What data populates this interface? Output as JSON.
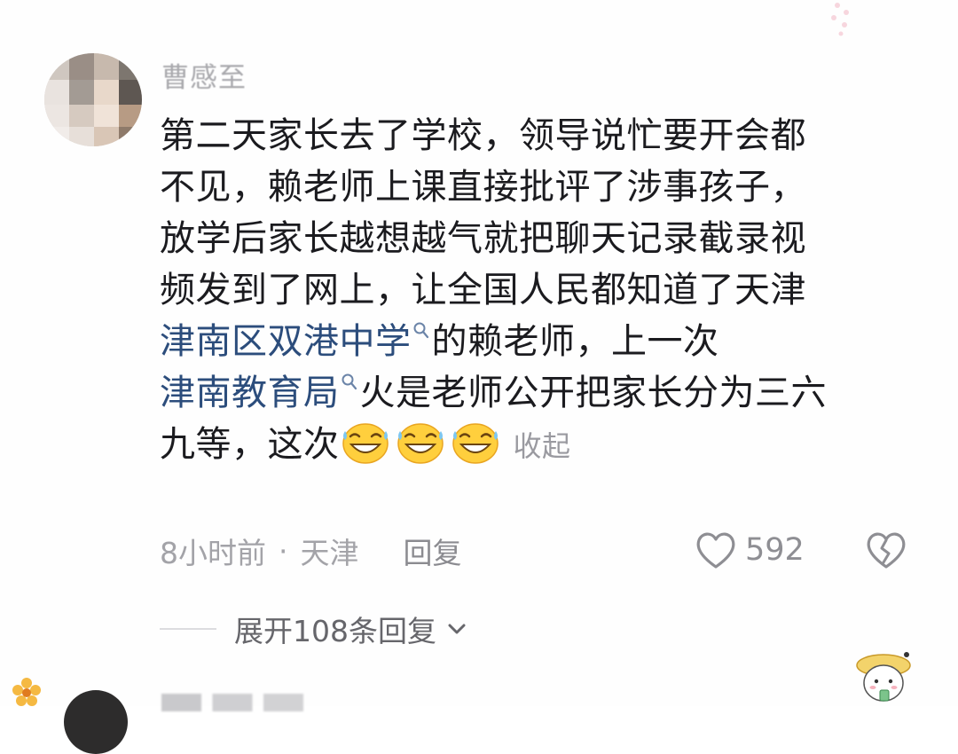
{
  "comment": {
    "username": "曹感至",
    "lines": [
      "第二天家长去了学校，领导说忙要开会都",
      "不见，赖老师上课直接批评了涉事孩子，",
      "放学后家长越想越气就把聊天记录截录视",
      "频发到了网上，让全国人民都知道了天津"
    ],
    "line5_link": "津南区双港中学",
    "line5_text": "的赖老师，上一次",
    "line6_link": "津南教育局",
    "line6_text": "火是老师公开把家长分为三六",
    "line7_text": "九等，这次",
    "emoji_name": "laugh-cry-emoji",
    "collapse_label": "收起",
    "time": "8小时前",
    "separator": "·",
    "location": "天津",
    "reply_label": "回复",
    "like_count": "592",
    "expand_label": "展开108条回复"
  },
  "colors": {
    "text": "#1b1b1f",
    "link": "#2c4d7c",
    "muted": "#a3a3a8"
  }
}
